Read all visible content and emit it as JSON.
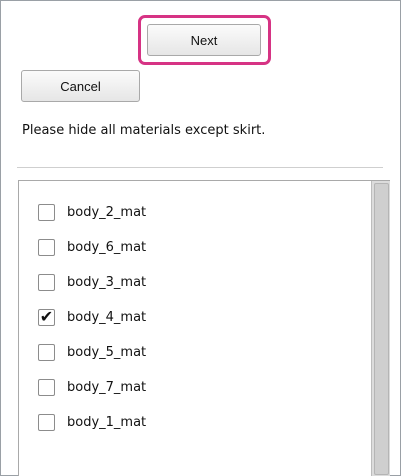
{
  "buttons": {
    "next_label": "Next",
    "cancel_label": "Cancel"
  },
  "instruction": "Please hide all materials except skirt.",
  "materials": [
    {
      "label": "body_2_mat",
      "checked": false
    },
    {
      "label": "body_6_mat",
      "checked": false
    },
    {
      "label": "body_3_mat",
      "checked": false
    },
    {
      "label": "body_4_mat",
      "checked": true
    },
    {
      "label": "body_5_mat",
      "checked": false
    },
    {
      "label": "body_7_mat",
      "checked": false
    },
    {
      "label": "body_1_mat",
      "checked": false
    }
  ],
  "colors": {
    "highlight": "#d63384"
  },
  "icons": {
    "check": "checkmark-icon"
  }
}
